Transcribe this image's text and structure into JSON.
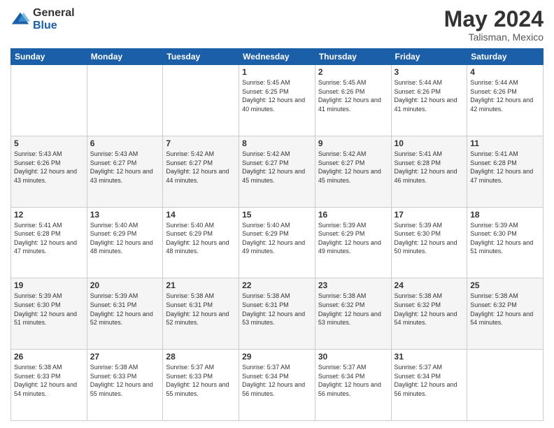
{
  "logo": {
    "general": "General",
    "blue": "Blue"
  },
  "header": {
    "month_year": "May 2024",
    "location": "Talisman, Mexico"
  },
  "weekdays": [
    "Sunday",
    "Monday",
    "Tuesday",
    "Wednesday",
    "Thursday",
    "Friday",
    "Saturday"
  ],
  "weeks": [
    [
      {
        "day": "",
        "sunrise": "",
        "sunset": "",
        "daylight": ""
      },
      {
        "day": "",
        "sunrise": "",
        "sunset": "",
        "daylight": ""
      },
      {
        "day": "",
        "sunrise": "",
        "sunset": "",
        "daylight": ""
      },
      {
        "day": "1",
        "sunrise": "Sunrise: 5:45 AM",
        "sunset": "Sunset: 6:25 PM",
        "daylight": "Daylight: 12 hours and 40 minutes."
      },
      {
        "day": "2",
        "sunrise": "Sunrise: 5:45 AM",
        "sunset": "Sunset: 6:26 PM",
        "daylight": "Daylight: 12 hours and 41 minutes."
      },
      {
        "day": "3",
        "sunrise": "Sunrise: 5:44 AM",
        "sunset": "Sunset: 6:26 PM",
        "daylight": "Daylight: 12 hours and 41 minutes."
      },
      {
        "day": "4",
        "sunrise": "Sunrise: 5:44 AM",
        "sunset": "Sunset: 6:26 PM",
        "daylight": "Daylight: 12 hours and 42 minutes."
      }
    ],
    [
      {
        "day": "5",
        "sunrise": "Sunrise: 5:43 AM",
        "sunset": "Sunset: 6:26 PM",
        "daylight": "Daylight: 12 hours and 43 minutes."
      },
      {
        "day": "6",
        "sunrise": "Sunrise: 5:43 AM",
        "sunset": "Sunset: 6:27 PM",
        "daylight": "Daylight: 12 hours and 43 minutes."
      },
      {
        "day": "7",
        "sunrise": "Sunrise: 5:42 AM",
        "sunset": "Sunset: 6:27 PM",
        "daylight": "Daylight: 12 hours and 44 minutes."
      },
      {
        "day": "8",
        "sunrise": "Sunrise: 5:42 AM",
        "sunset": "Sunset: 6:27 PM",
        "daylight": "Daylight: 12 hours and 45 minutes."
      },
      {
        "day": "9",
        "sunrise": "Sunrise: 5:42 AM",
        "sunset": "Sunset: 6:27 PM",
        "daylight": "Daylight: 12 hours and 45 minutes."
      },
      {
        "day": "10",
        "sunrise": "Sunrise: 5:41 AM",
        "sunset": "Sunset: 6:28 PM",
        "daylight": "Daylight: 12 hours and 46 minutes."
      },
      {
        "day": "11",
        "sunrise": "Sunrise: 5:41 AM",
        "sunset": "Sunset: 6:28 PM",
        "daylight": "Daylight: 12 hours and 47 minutes."
      }
    ],
    [
      {
        "day": "12",
        "sunrise": "Sunrise: 5:41 AM",
        "sunset": "Sunset: 6:28 PM",
        "daylight": "Daylight: 12 hours and 47 minutes."
      },
      {
        "day": "13",
        "sunrise": "Sunrise: 5:40 AM",
        "sunset": "Sunset: 6:29 PM",
        "daylight": "Daylight: 12 hours and 48 minutes."
      },
      {
        "day": "14",
        "sunrise": "Sunrise: 5:40 AM",
        "sunset": "Sunset: 6:29 PM",
        "daylight": "Daylight: 12 hours and 48 minutes."
      },
      {
        "day": "15",
        "sunrise": "Sunrise: 5:40 AM",
        "sunset": "Sunset: 6:29 PM",
        "daylight": "Daylight: 12 hours and 49 minutes."
      },
      {
        "day": "16",
        "sunrise": "Sunrise: 5:39 AM",
        "sunset": "Sunset: 6:29 PM",
        "daylight": "Daylight: 12 hours and 49 minutes."
      },
      {
        "day": "17",
        "sunrise": "Sunrise: 5:39 AM",
        "sunset": "Sunset: 6:30 PM",
        "daylight": "Daylight: 12 hours and 50 minutes."
      },
      {
        "day": "18",
        "sunrise": "Sunrise: 5:39 AM",
        "sunset": "Sunset: 6:30 PM",
        "daylight": "Daylight: 12 hours and 51 minutes."
      }
    ],
    [
      {
        "day": "19",
        "sunrise": "Sunrise: 5:39 AM",
        "sunset": "Sunset: 6:30 PM",
        "daylight": "Daylight: 12 hours and 51 minutes."
      },
      {
        "day": "20",
        "sunrise": "Sunrise: 5:39 AM",
        "sunset": "Sunset: 6:31 PM",
        "daylight": "Daylight: 12 hours and 52 minutes."
      },
      {
        "day": "21",
        "sunrise": "Sunrise: 5:38 AM",
        "sunset": "Sunset: 6:31 PM",
        "daylight": "Daylight: 12 hours and 52 minutes."
      },
      {
        "day": "22",
        "sunrise": "Sunrise: 5:38 AM",
        "sunset": "Sunset: 6:31 PM",
        "daylight": "Daylight: 12 hours and 53 minutes."
      },
      {
        "day": "23",
        "sunrise": "Sunrise: 5:38 AM",
        "sunset": "Sunset: 6:32 PM",
        "daylight": "Daylight: 12 hours and 53 minutes."
      },
      {
        "day": "24",
        "sunrise": "Sunrise: 5:38 AM",
        "sunset": "Sunset: 6:32 PM",
        "daylight": "Daylight: 12 hours and 54 minutes."
      },
      {
        "day": "25",
        "sunrise": "Sunrise: 5:38 AM",
        "sunset": "Sunset: 6:32 PM",
        "daylight": "Daylight: 12 hours and 54 minutes."
      }
    ],
    [
      {
        "day": "26",
        "sunrise": "Sunrise: 5:38 AM",
        "sunset": "Sunset: 6:33 PM",
        "daylight": "Daylight: 12 hours and 54 minutes."
      },
      {
        "day": "27",
        "sunrise": "Sunrise: 5:38 AM",
        "sunset": "Sunset: 6:33 PM",
        "daylight": "Daylight: 12 hours and 55 minutes."
      },
      {
        "day": "28",
        "sunrise": "Sunrise: 5:37 AM",
        "sunset": "Sunset: 6:33 PM",
        "daylight": "Daylight: 12 hours and 55 minutes."
      },
      {
        "day": "29",
        "sunrise": "Sunrise: 5:37 AM",
        "sunset": "Sunset: 6:34 PM",
        "daylight": "Daylight: 12 hours and 56 minutes."
      },
      {
        "day": "30",
        "sunrise": "Sunrise: 5:37 AM",
        "sunset": "Sunset: 6:34 PM",
        "daylight": "Daylight: 12 hours and 56 minutes."
      },
      {
        "day": "31",
        "sunrise": "Sunrise: 5:37 AM",
        "sunset": "Sunset: 6:34 PM",
        "daylight": "Daylight: 12 hours and 56 minutes."
      },
      {
        "day": "",
        "sunrise": "",
        "sunset": "",
        "daylight": ""
      }
    ]
  ]
}
